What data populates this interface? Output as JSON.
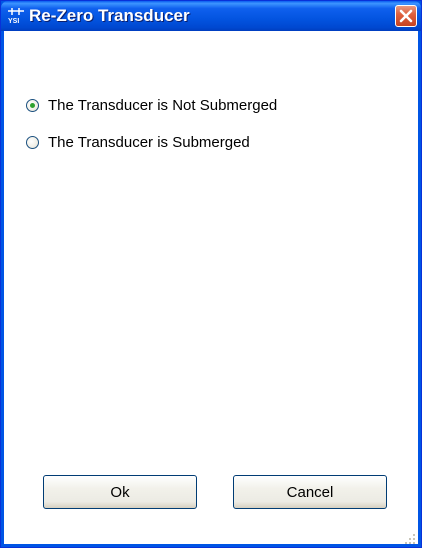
{
  "window": {
    "title": "Re-Zero Transducer"
  },
  "options": [
    {
      "label": "The Transducer is Not Submerged",
      "checked": true
    },
    {
      "label": "The Transducer is Submerged",
      "checked": false
    }
  ],
  "buttons": {
    "ok": "Ok",
    "cancel": "Cancel"
  },
  "icons": {
    "app": "ysi-app-icon",
    "close": "close-icon",
    "grip": "resize-grip-icon"
  },
  "colors": {
    "titlebar": "#0054e3",
    "close": "#e0613f",
    "radio_dot": "#2fa12f"
  }
}
